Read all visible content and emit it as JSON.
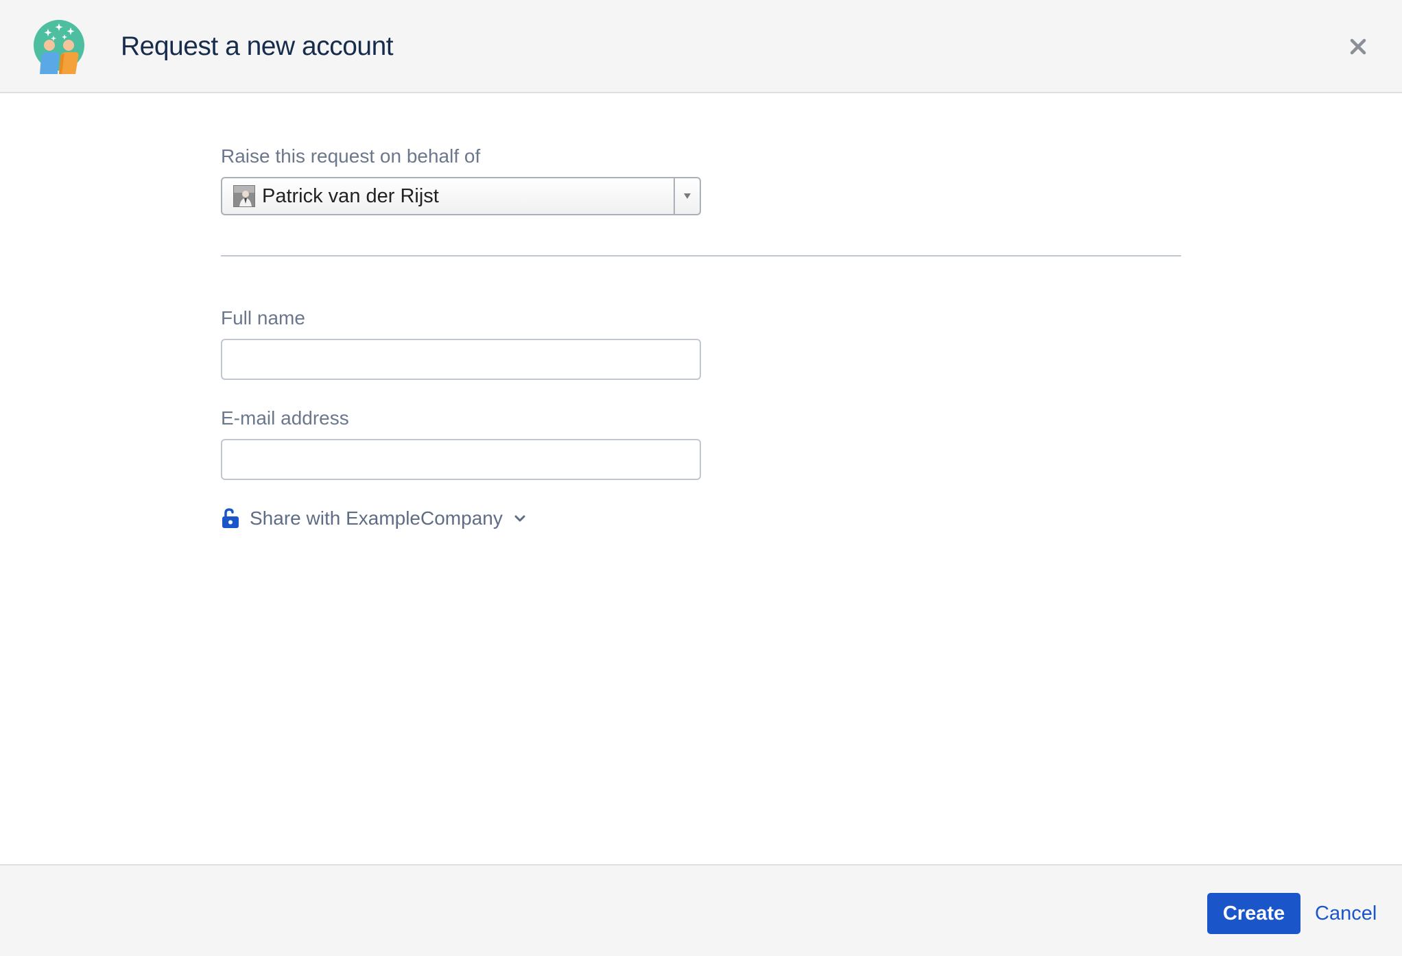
{
  "dialog": {
    "title": "Request a new account",
    "close_icon": "close-icon",
    "logo_icon": "request-type-people-icon"
  },
  "form": {
    "on_behalf": {
      "label": "Raise this request on behalf of",
      "selected_value": "Patrick van der Rijst"
    },
    "full_name": {
      "label": "Full name",
      "value": ""
    },
    "email": {
      "label": "E-mail address",
      "value": ""
    },
    "share": {
      "label": "Share with ExampleCompany",
      "icon": "unlock-icon"
    }
  },
  "footer": {
    "create_label": "Create",
    "cancel_label": "Cancel"
  },
  "colors": {
    "primary": "#1a56c9",
    "title": "#172b4d",
    "label": "#6b778c",
    "header_bg": "#f5f5f5"
  }
}
